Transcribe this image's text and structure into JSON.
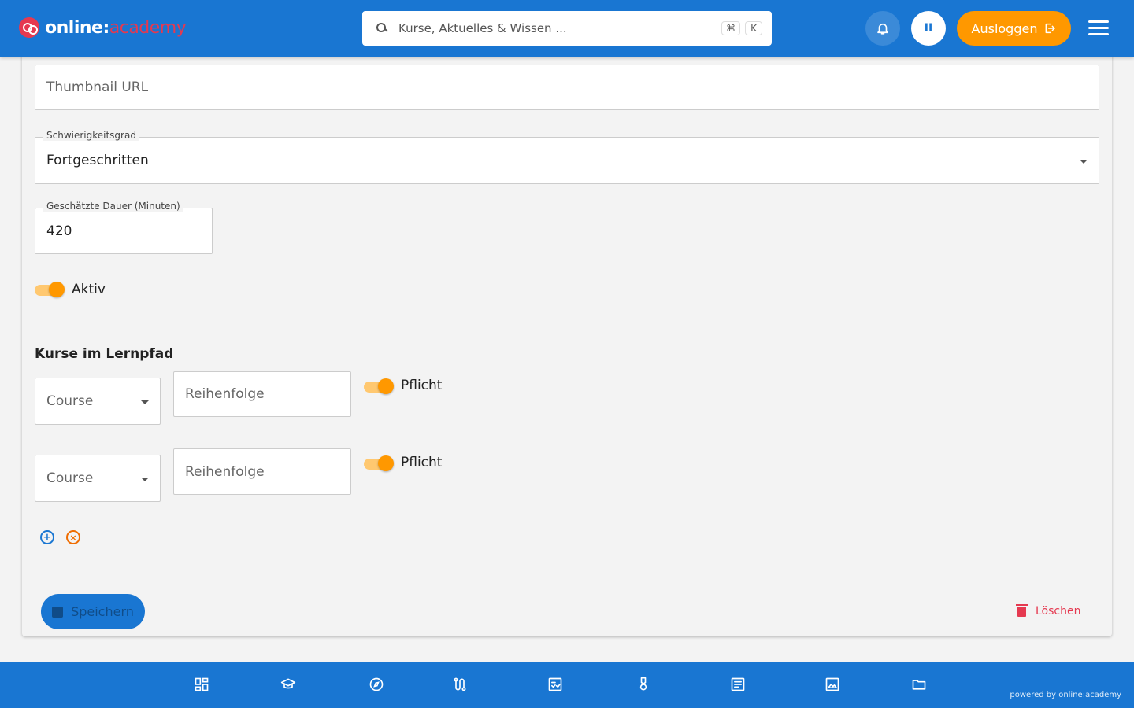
{
  "header": {
    "logo_main": "online:",
    "logo_accent": "academy",
    "search_placeholder": "Kurse, Aktuelles & Wissen ...",
    "shortcut_key1": "⌘",
    "shortcut_key2": "K",
    "avatar_initials": "II",
    "logout_label": "Ausloggen"
  },
  "form": {
    "thumbnail_placeholder": "Thumbnail URL",
    "difficulty_label": "Schwierigkeitsgrad",
    "difficulty_value": "Fortgeschritten",
    "duration_label": "Geschätzte Dauer (Minuten)",
    "duration_value": "420",
    "active_label": "Aktiv",
    "active_on": true
  },
  "courses": {
    "section_title": "Kurse im Lernpfad",
    "rows": [
      {
        "course_placeholder": "Course",
        "order_placeholder": "Reihenfolge",
        "required_label": "Pflicht",
        "required_on": true
      },
      {
        "course_placeholder": "Course",
        "order_placeholder": "Reihenfolge",
        "required_label": "Pflicht",
        "required_on": true
      }
    ]
  },
  "actions": {
    "save_label": "Speichern",
    "delete_label": "Löschen"
  },
  "footer": {
    "powered_by": "powered by online:academy",
    "nav_icons": [
      "dashboard-icon",
      "school-icon",
      "compass-icon",
      "route-icon",
      "checklist-icon",
      "award-icon",
      "article-icon",
      "image-icon",
      "folder-icon"
    ]
  },
  "colors": {
    "primary": "#1976d2",
    "accent": "#ff9800",
    "brand_red": "#e53950",
    "background": "#f3f3f3"
  }
}
